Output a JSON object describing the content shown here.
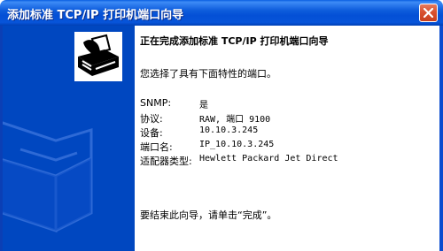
{
  "window": {
    "title": "添加标准 TCP/IP 打印机端口向导"
  },
  "content": {
    "heading": "正在完成添加标准 TCP/IP 打印机端口向导",
    "intro": "您选择了具有下面特性的端口。",
    "properties": [
      {
        "key": "SNMP:",
        "value": "是"
      },
      {
        "key": "协议:",
        "value": "RAW, 端口 9100"
      },
      {
        "key": "设备:",
        "value": "10.10.3.245"
      },
      {
        "key": "端口名:",
        "value": "IP_10.10.3.245"
      },
      {
        "key": "适配器类型:",
        "value": "Hewlett Packard Jet Direct"
      }
    ],
    "finish_text": "要结束此向导，请单击“完成”。"
  },
  "icons": {
    "close": "close-icon",
    "wizard": "printer-wizard-icon",
    "art": "printer-watermark-art"
  },
  "colors": {
    "titlebar": "#0450d6",
    "side_panel": "#0047c0",
    "close_button": "#d9512f"
  }
}
